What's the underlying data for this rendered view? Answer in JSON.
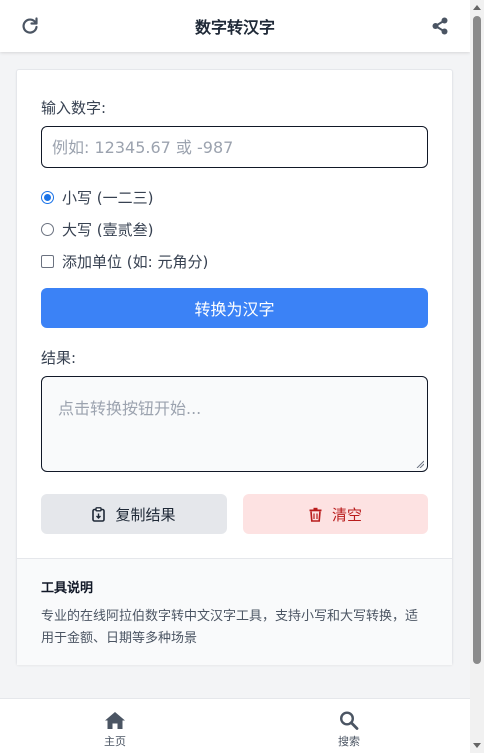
{
  "header": {
    "title": "数字转汉字",
    "left_icon": "refresh-icon",
    "right_icon": "share-icon"
  },
  "form": {
    "input_label": "输入数字:",
    "input_placeholder": "例如: 12345.67 或 -987",
    "input_value": "",
    "options": {
      "lowercase": "小写 (一二三)",
      "uppercase": "大写 (壹贰叁)",
      "add_unit": "添加单位 (如: 元角分)"
    },
    "selected_case": "lowercase",
    "add_unit_checked": false,
    "convert_label": "转换为汉字",
    "result_label": "结果:",
    "result_placeholder": "点击转换按钮开始...",
    "copy_label": "复制结果",
    "clear_label": "清空"
  },
  "info": {
    "title": "工具说明",
    "text": "专业的在线阿拉伯数字转中文汉字工具，支持小写和大写转换，适用于金额、日期等多种场景"
  },
  "nav": {
    "home": "主页",
    "search": "搜索"
  },
  "colors": {
    "primary": "#3b82f6",
    "danger_bg": "#fde2e2",
    "danger_text": "#b91c1c",
    "radio_accent": "#1a73e8"
  }
}
